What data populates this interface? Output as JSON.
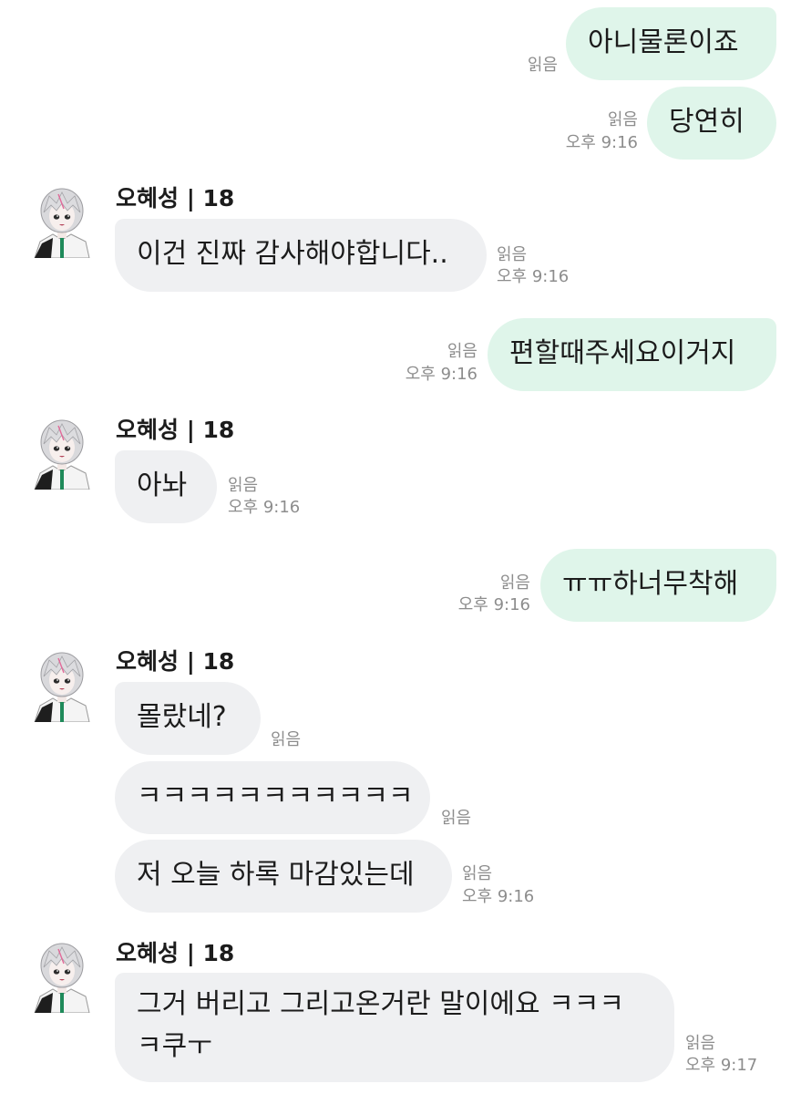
{
  "chat": {
    "sender_name": "오혜성 | 18",
    "read_label": "읽음",
    "messages": [
      {
        "id": "m1",
        "dir": "out",
        "text": "아니물론이죠",
        "read": "읽음",
        "time": ""
      },
      {
        "id": "m2",
        "dir": "out",
        "text": "당연히",
        "read": "읽음",
        "time": "오후 9:16"
      },
      {
        "id": "m3",
        "dir": "in",
        "text": "이건 진짜 감사해야합니다..",
        "read": "읽음",
        "time": "오후 9:16"
      },
      {
        "id": "m4",
        "dir": "out",
        "text": "편할때주세요이거지",
        "read": "읽음",
        "time": "오후 9:16"
      },
      {
        "id": "m5",
        "dir": "in",
        "text": "아놔",
        "read": "읽음",
        "time": "오후 9:16"
      },
      {
        "id": "m6",
        "dir": "out",
        "text": "ㅠㅠ하너무착해",
        "read": "읽음",
        "time": "오후 9:16"
      },
      {
        "id": "m7",
        "dir": "in",
        "text": "몰랐네?",
        "read": "읽음",
        "time": ""
      },
      {
        "id": "m8",
        "dir": "in",
        "text": "ㅋㅋㅋㅋㅋㅋㅋㅋㅋㅋㅋ",
        "read": "읽음",
        "time": ""
      },
      {
        "id": "m9",
        "dir": "in",
        "text": "저 오늘 하록 마감있는데",
        "read": "읽음",
        "time": "오후 9:16"
      },
      {
        "id": "m10",
        "dir": "in",
        "text_line1": "그거 버리고 그리고온거란 말이에요 ㅋㅋㅋ",
        "text_line2": "ㅋ쿠ㅜ",
        "read": "읽음",
        "time": "오후 9:17"
      }
    ]
  },
  "colors": {
    "outgoing_bubble": "#dff5ea",
    "incoming_bubble": "#eff0f2",
    "meta_text": "#8d8d8d"
  },
  "icons": {
    "avatar": "anime-avatar-icon"
  }
}
